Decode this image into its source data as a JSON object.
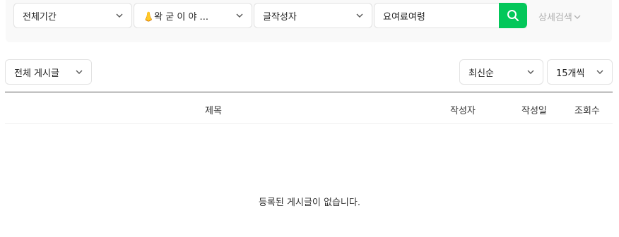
{
  "search": {
    "period": "전체기간",
    "board": "👃왁 굳 이 야 ...",
    "field": "글작성자",
    "query": "요여료여령",
    "detail_link": "상세검색"
  },
  "filter": {
    "post_type": "전체 게시글",
    "sort": "최신순",
    "per_page": "15개씩"
  },
  "table": {
    "headers": {
      "title": "제목",
      "author": "작성자",
      "date": "작성일",
      "views": "조회수"
    },
    "empty_message": "등록된 게시글이 없습니다."
  },
  "colors": {
    "accent": "#03c75a",
    "muted": "#b0b0b0"
  },
  "icons": [
    "chevron-down-icon",
    "search-icon"
  ]
}
